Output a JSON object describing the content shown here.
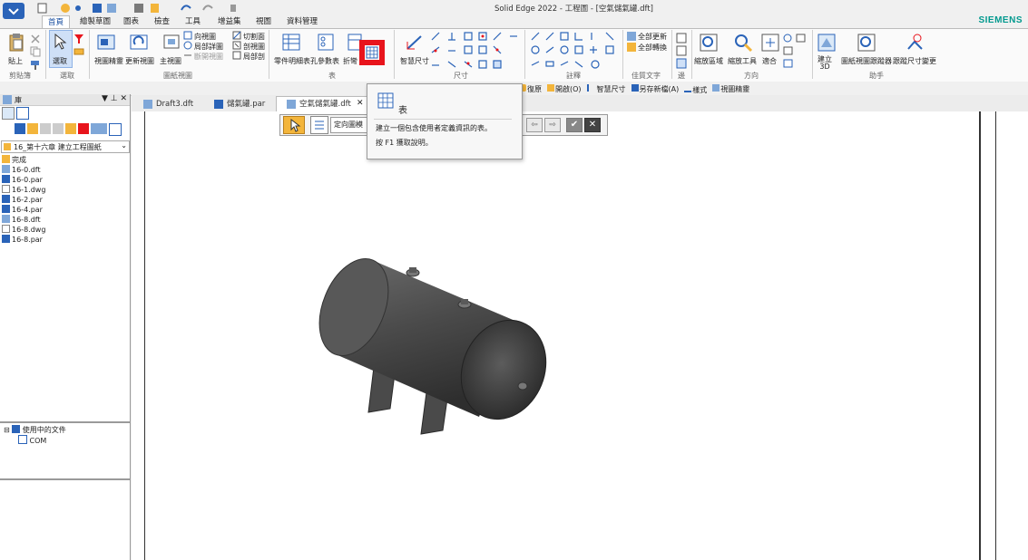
{
  "app": {
    "title": "Solid Edge 2022 - 工程圖 - [空氣儲氣罐.dft]",
    "brand": "SIEMENS",
    "brand_color": "#00998e",
    "accent": "#1a4fa0",
    "highlight": "#e8141c"
  },
  "ribbon_tabs": [
    "首頁",
    "繪製草圖",
    "圖表",
    "檢查",
    "工具",
    "增益集",
    "視圖",
    "資料管理"
  ],
  "ribbon": {
    "paste": "貼上",
    "select": "選取",
    "view_wizard": "視圖精靈",
    "update_views": "更新視圖",
    "main_view": "主視圖",
    "aux_view": "向視圖",
    "detail_view": "局部詳圖",
    "broken_view": "斷開視圖",
    "cut_plane": "切割面",
    "section_view": "剖視圖",
    "broken_out": "局部剖",
    "parts_list": "零件明細表",
    "hole_table": "孔參數表",
    "fold_table": "折彎",
    "smart_dim": "智慧尺寸",
    "update_all": "全部更新",
    "convert_all": "全部轉換",
    "zoom_area": "縮放區域",
    "zoom_tool": "縮放工具",
    "fit": "適合",
    "create_3d": "建立 3D",
    "sheet_tracker": "圖紙視圖跟蹤器",
    "dim_tracker": "跟蹤尺寸變更",
    "groups": {
      "clipboard": "剪貼簿",
      "select": "選取",
      "drawing_views": "圖紙視圖",
      "table": "表",
      "dimension": "尺寸",
      "annotation": "註釋",
      "text": "佳質文字",
      "edge": "邊",
      "orient": "方向",
      "assistant": "助手"
    }
  },
  "toolbar2": [
    "復原",
    "開啟(O)",
    "智慧尺寸",
    "另存新檔(A)",
    "樣式",
    "視圖精靈"
  ],
  "left_panel": {
    "label": "庫",
    "folder": "16_第十六章 建立工程圖紙",
    "files": [
      "完成",
      "16-0.dft",
      "16-0.par",
      "16-1.dwg",
      "16-2.par",
      "16-4.par",
      "16-8.dft",
      "16-8.dwg",
      "16-8.par"
    ],
    "docs_title": "使用中的文件",
    "docs_child": "COM"
  },
  "doc_tabs": [
    "Draft3.dft",
    "儲氣罐.par",
    "空氣儲氣罐.dft"
  ],
  "command_bar": {
    "field": "定向圖模"
  },
  "tooltip": {
    "title": "表",
    "description": "建立一個包含使用者定義資訊的表。",
    "help": "按 F1 獲取說明。"
  }
}
